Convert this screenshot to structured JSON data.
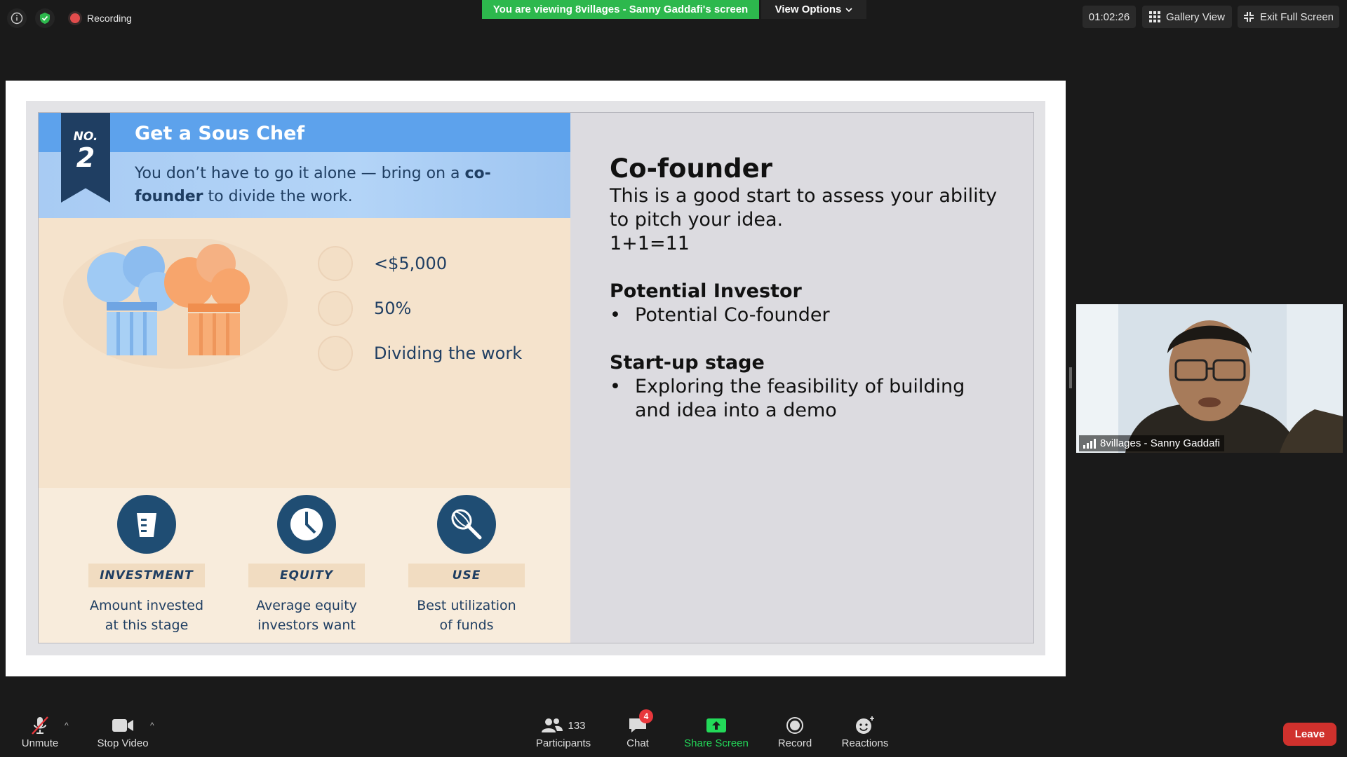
{
  "top_bar": {
    "recording_label": "Recording",
    "viewing_banner": "You are viewing 8villages - Sanny Gaddafi's screen",
    "view_options_label": "View Options",
    "timer": "01:02:26",
    "gallery_view_label": "Gallery View",
    "exit_full_screen_label": "Exit Full Screen"
  },
  "slide": {
    "infographic": {
      "ribbon_no": "NO.",
      "ribbon_number": "2",
      "title": "Get a Sous Chef",
      "subtitle_part1": "You don’t have to go it alone — bring on a",
      "subtitle_bold": "co-founder",
      "subtitle_part2": "to divide the work.",
      "stats": [
        "<$5,000",
        "50%",
        "Dividing the work"
      ],
      "legend": [
        {
          "tag": "INVESTMENT",
          "desc_line1": "Amount invested",
          "desc_line2": "at this stage"
        },
        {
          "tag": "EQUITY",
          "desc_line1": "Average equity",
          "desc_line2": "investors want"
        },
        {
          "tag": "USE",
          "desc_line1": "Best utilization",
          "desc_line2": "of funds"
        }
      ]
    },
    "text": {
      "title": "Co-founder",
      "line1": "This is a good start to assess your ability",
      "line2": "to pitch your idea.",
      "line3": "1+1=11",
      "heading2": "Potential Investor",
      "bullet1": "Potential Co-founder",
      "heading3": "Start-up stage",
      "bullet2_line1": "Exploring the feasibility of building",
      "bullet2_line2": "and idea into a demo",
      "bullet_char": "•"
    }
  },
  "participant_video": {
    "name": "8villages - Sanny Gaddafi"
  },
  "toolbar": {
    "unmute_label": "Unmute",
    "stop_video_label": "Stop Video",
    "participants_label": "Participants",
    "participants_count": "133",
    "chat_label": "Chat",
    "chat_badge": "4",
    "share_screen_label": "Share Screen",
    "record_label": "Record",
    "reactions_label": "Reactions",
    "leave_label": "Leave"
  },
  "colors": {
    "banner_green": "#2db84d",
    "share_green": "#23d959",
    "leave_red": "#d0312d",
    "navy": "#1f3e62"
  }
}
